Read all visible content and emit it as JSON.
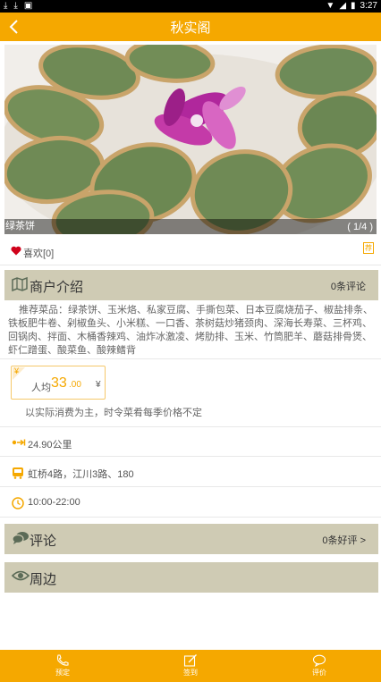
{
  "status_bar": {
    "time": "3:27"
  },
  "header": {
    "title": "秋实阁"
  },
  "gallery": {
    "caption": "绿茶饼",
    "counter": "( 1/4 )"
  },
  "like": {
    "label": "喜欢[0]",
    "recommend_badge": "荐"
  },
  "merchant": {
    "section_title": "商户介绍",
    "review_count": "0条评论",
    "description": "推荐菜品：绿茶饼、玉米烙、私家豆腐、手撕包菜、日本豆腐烧茄子、椒盐排条、铁板肥牛卷、剁椒鱼头、小米糕、一口香、茶树菇炒猪颈肉、深海长寿菜、三杯鸡、回锅肉、拌面、木桶香辣鸡、油炸冰激凌、烤肋排、玉米、竹筒肥羊、蘑菇排骨煲、虾仁蹭蛋、酸菜鱼、酸辣鳍背",
    "price_label": "人均",
    "price_amount": "33",
    "price_cents": ".00",
    "price_unit": "¥",
    "price_icon_char": "¥",
    "price_note": "以实际消费为主，时令菜肴每季价格不定",
    "distance": "24.90公里",
    "bus": "虹桥4路，江川3路、180",
    "hours": "10:00-22:00"
  },
  "reviews": {
    "section_title": "评论",
    "good_count": "0条好评",
    "chevron": ">"
  },
  "nearby": {
    "section_title": "周边"
  },
  "bottom_nav": [
    {
      "label": "预定",
      "icon": "phone-icon"
    },
    {
      "label": "签到",
      "icon": "edit-icon"
    },
    {
      "label": "评价",
      "icon": "chat-bubble-icon"
    }
  ],
  "colors": {
    "accent": "#f5a800",
    "section_bg": "#cfcbb4",
    "heart": "#d0021b"
  }
}
